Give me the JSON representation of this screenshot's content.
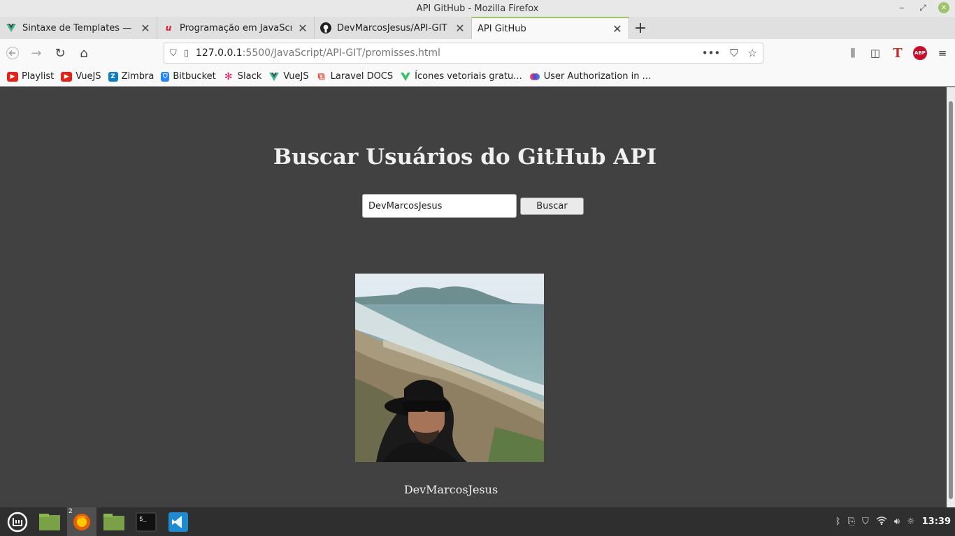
{
  "window": {
    "title": "API GitHub - Mozilla Firefox"
  },
  "tabs": [
    {
      "label": "Sintaxe de Templates — Vue",
      "icon": "vue-icon"
    },
    {
      "label": "Programação em JavaScript",
      "icon": "udemy-icon"
    },
    {
      "label": "DevMarcosJesus/API-GIT",
      "icon": "github-icon"
    },
    {
      "label": "API GitHub",
      "icon": "page-icon"
    }
  ],
  "urlbar": {
    "host": "127.0.0.1",
    "path": ":5500/JavaScript/API-GIT/promisses.html"
  },
  "bookmarks": [
    {
      "label": "Playlist",
      "icon": "youtube-icon",
      "color": "#e62117"
    },
    {
      "label": "VueJS",
      "icon": "youtube-icon",
      "color": "#e62117"
    },
    {
      "label": "Zimbra",
      "icon": "zimbra-icon",
      "color": "#0b7dc1"
    },
    {
      "label": "Bitbucket",
      "icon": "bitbucket-icon",
      "color": "#2684ff"
    },
    {
      "label": "Slack",
      "icon": "slack-icon",
      "color": "#4a154b"
    },
    {
      "label": "VueJS",
      "icon": "vue-icon",
      "color": "#41b883"
    },
    {
      "label": "Laravel DOCS",
      "icon": "laravel-icon",
      "color": "#f05340"
    },
    {
      "label": "Ícones vetoriais gratu...",
      "icon": "vector-icon",
      "color": "#3dbd6b"
    },
    {
      "label": "User Authorization in ...",
      "icon": "app-icon",
      "color": "#7b3fe4"
    }
  ],
  "page": {
    "title": "Buscar Usuários do GitHub API",
    "search_value": "DevMarcosJesus",
    "search_button": "Buscar",
    "username": "DevMarcosJesus"
  },
  "taskbar": {
    "firefox_badge": "2",
    "clock": "13:39"
  }
}
